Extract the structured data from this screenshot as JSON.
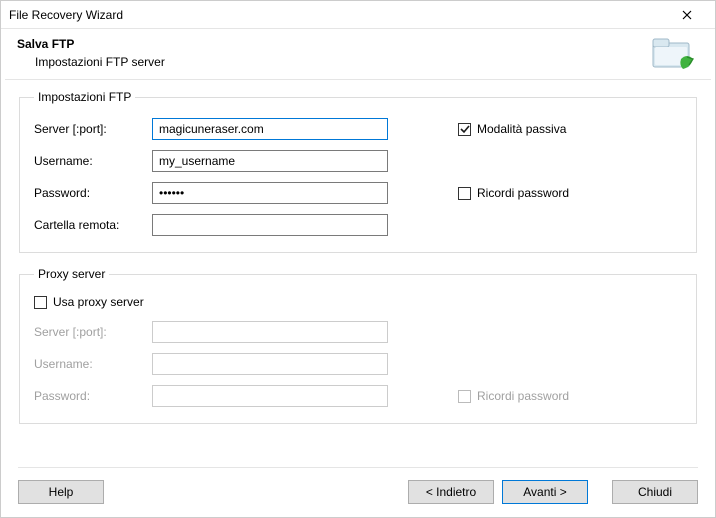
{
  "window": {
    "title": "File Recovery Wizard"
  },
  "header": {
    "title": "Salva FTP",
    "subtitle": "Impostazioni FTP server"
  },
  "ftp": {
    "legend": "Impostazioni FTP",
    "server_label": "Server [:port]:",
    "server_value": "magicuneraser.com",
    "username_label": "Username:",
    "username_value": "my_username",
    "password_label": "Password:",
    "password_value": "••••••",
    "remote_label": "Cartella remota:",
    "remote_value": "",
    "passive_label": "Modalità passiva",
    "passive_checked": true,
    "remember_label": "Ricordi password",
    "remember_checked": false
  },
  "proxy": {
    "legend": "Proxy server",
    "use_label": "Usa proxy server",
    "use_checked": false,
    "server_label": "Server [:port]:",
    "server_value": "",
    "username_label": "Username:",
    "username_value": "",
    "password_label": "Password:",
    "password_value": "",
    "remember_label": "Ricordi password",
    "remember_checked": false
  },
  "buttons": {
    "help": "Help",
    "back": "< Indietro",
    "next": "Avanti >",
    "close": "Chiudi"
  }
}
